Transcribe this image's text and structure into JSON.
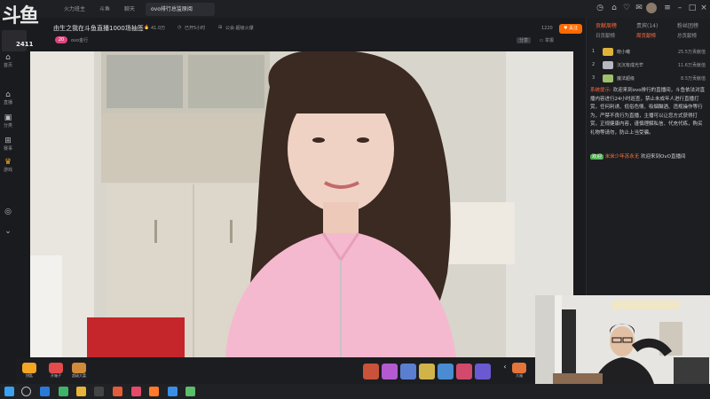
{
  "titlebar": {
    "logo": "斗鱼",
    "tabs": [
      {
        "label": "火力班主"
      },
      {
        "label": "斗鱼"
      },
      {
        "label": "聊天"
      },
      {
        "label": "ovo排行总监原阅"
      }
    ]
  },
  "leftnav": {
    "items": [
      {
        "label": "首页"
      },
      {
        "label": "直播"
      },
      {
        "label": "分类"
      },
      {
        "label": "赛事"
      },
      {
        "label": "游戏"
      }
    ],
    "mini_label": "2411"
  },
  "stream": {
    "title": "由生之我在斗鱼直播1000场抽签",
    "heat": "41.0万",
    "viewers": "已开5小时",
    "category": "公会·超级火爆",
    "anchor": "ovo金行",
    "level": "20",
    "follow_label": "关注",
    "follow_count": "1220",
    "actions": [
      "分享",
      "举报"
    ]
  },
  "player_bar": {
    "buttons": [
      {
        "label": "钥匙"
      },
      {
        "label": "开箱子"
      },
      {
        "label": "超级大富"
      }
    ],
    "tail_label": "大福"
  },
  "rightpanel": {
    "tabs": [
      {
        "label": "贡献周榜",
        "active": true
      },
      {
        "label": "贵宾(14)"
      },
      {
        "label": "粉丝团榜"
      }
    ],
    "subtabs": [
      {
        "label": "日贡献榜"
      },
      {
        "label": "周贡献榜",
        "active": true
      },
      {
        "label": "总贡献榜"
      }
    ],
    "ranks": [
      {
        "num": "1",
        "name": "晓小曦",
        "value": "25.5万贡献值"
      },
      {
        "num": "2",
        "name": "沉沉有成光芒",
        "value": "11.6万贡献值"
      },
      {
        "num": "3",
        "name": "魔法超级",
        "value": "8.5万贡献值"
      }
    ],
    "system_tag": "系统提示:",
    "system_msg": "欢迎来到ovo排行的直播间，斗鱼依法对直播内容进行24小时巡查，禁止未成年人进行直播打赏，任何利诱、低俗色情、吸烟酗酒、违规操作等行为，严禁不良行为直播，主播可以让您方式获得打赏，正规健康内容，谨慎理解私信、代充代练，购买礼物等请勿，防止上当受骗。",
    "welcome_tag": "欢迎",
    "welcome_user": "米米少年苏永无",
    "welcome_text": "欢迎来到OvO直播间"
  },
  "colors": {
    "accent": "#ff6b3d",
    "follow": "#ff6a00",
    "level": "#e0457b",
    "bg": "#1a1b1f"
  }
}
